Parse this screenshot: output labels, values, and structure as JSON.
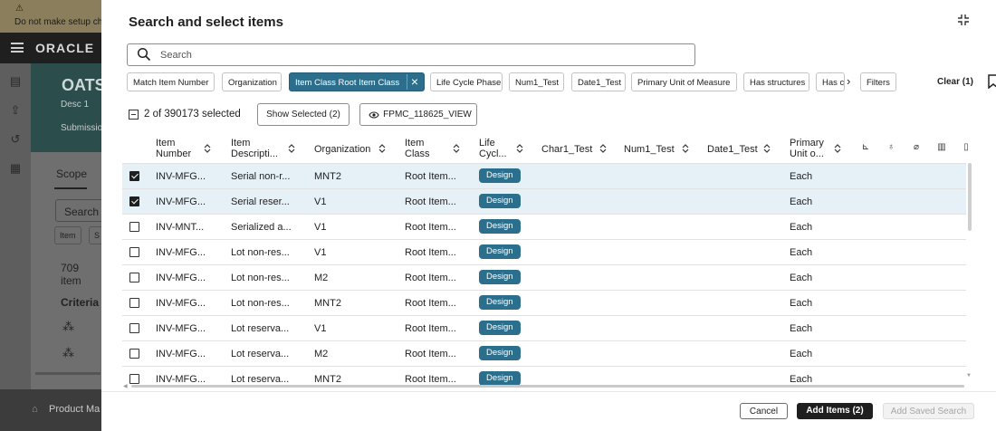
{
  "background": {
    "warning_text": "Do not make setup ch",
    "brand": "ORACLE",
    "hero_title": "OATS",
    "hero_desc": "Desc 1",
    "hero_sub": "Submission",
    "scope_tab": "Scope",
    "search_label": "Search",
    "chips": [
      "Item",
      "S"
    ],
    "items_count": "709 item",
    "criteria_label": "Criteria",
    "footer_label": "Product Ma"
  },
  "modal": {
    "title": "Search and select items",
    "search": {
      "placeholder": "Search",
      "value": ""
    },
    "filters": [
      "Match Item Number",
      "Organization",
      "Item Class Root Item Class",
      "Life Cycle Phase",
      "Num1_Test",
      "Date1_Test",
      "Primary Unit of Measure",
      "Has structures",
      "Has c",
      "Filters"
    ],
    "clear_label": "Clear (1)",
    "selection": {
      "count_text": "2 of 390173 selected",
      "show_selected_label": "Show Selected (2)",
      "view_label": "FPMC_118625_VIEW"
    },
    "columns": {
      "item_number": "Item Number",
      "item_description": "Item Descripti...",
      "organization": "Organization",
      "item_class": "Item Class",
      "lifecycle": "Life Cycl...",
      "char1": "Char1_Test",
      "num1": "Num1_Test",
      "date1": "Date1_Test",
      "uom": "Primary Unit o..."
    },
    "rows": [
      {
        "selected": true,
        "item_number": "INV-MFG...",
        "description": "Serial non-r...",
        "organization": "MNT2",
        "item_class": "Root Item...",
        "lifecycle": "Design",
        "uom": "Each"
      },
      {
        "selected": true,
        "item_number": "INV-MFG...",
        "description": "Serial reser...",
        "organization": "V1",
        "item_class": "Root Item...",
        "lifecycle": "Design",
        "uom": "Each"
      },
      {
        "selected": false,
        "item_number": "INV-MNT...",
        "description": "Serialized a...",
        "organization": "V1",
        "item_class": "Root Item...",
        "lifecycle": "Design",
        "uom": "Each"
      },
      {
        "selected": false,
        "item_number": "INV-MFG...",
        "description": "Lot non-res...",
        "organization": "V1",
        "item_class": "Root Item...",
        "lifecycle": "Design",
        "uom": "Each"
      },
      {
        "selected": false,
        "item_number": "INV-MFG...",
        "description": "Lot non-res...",
        "organization": "M2",
        "item_class": "Root Item...",
        "lifecycle": "Design",
        "uom": "Each"
      },
      {
        "selected": false,
        "item_number": "INV-MFG...",
        "description": "Lot non-res...",
        "organization": "MNT2",
        "item_class": "Root Item...",
        "lifecycle": "Design",
        "uom": "Each"
      },
      {
        "selected": false,
        "item_number": "INV-MFG...",
        "description": "Lot reserva...",
        "organization": "V1",
        "item_class": "Root Item...",
        "lifecycle": "Design",
        "uom": "Each"
      },
      {
        "selected": false,
        "item_number": "INV-MFG...",
        "description": "Lot reserva...",
        "organization": "M2",
        "item_class": "Root Item...",
        "lifecycle": "Design",
        "uom": "Each"
      },
      {
        "selected": false,
        "item_number": "INV-MFG...",
        "description": "Lot reserva...",
        "organization": "MNT2",
        "item_class": "Root Item...",
        "lifecycle": "Design",
        "uom": "Each"
      }
    ],
    "footer": {
      "cancel_label": "Cancel",
      "add_label": "Add Items (2)",
      "saved_search_label": "Add Saved Search"
    }
  },
  "colors": {
    "accent": "#2b6f8c",
    "selected_row": "#e5f1f7",
    "primary_button": "#1f1f1f"
  }
}
